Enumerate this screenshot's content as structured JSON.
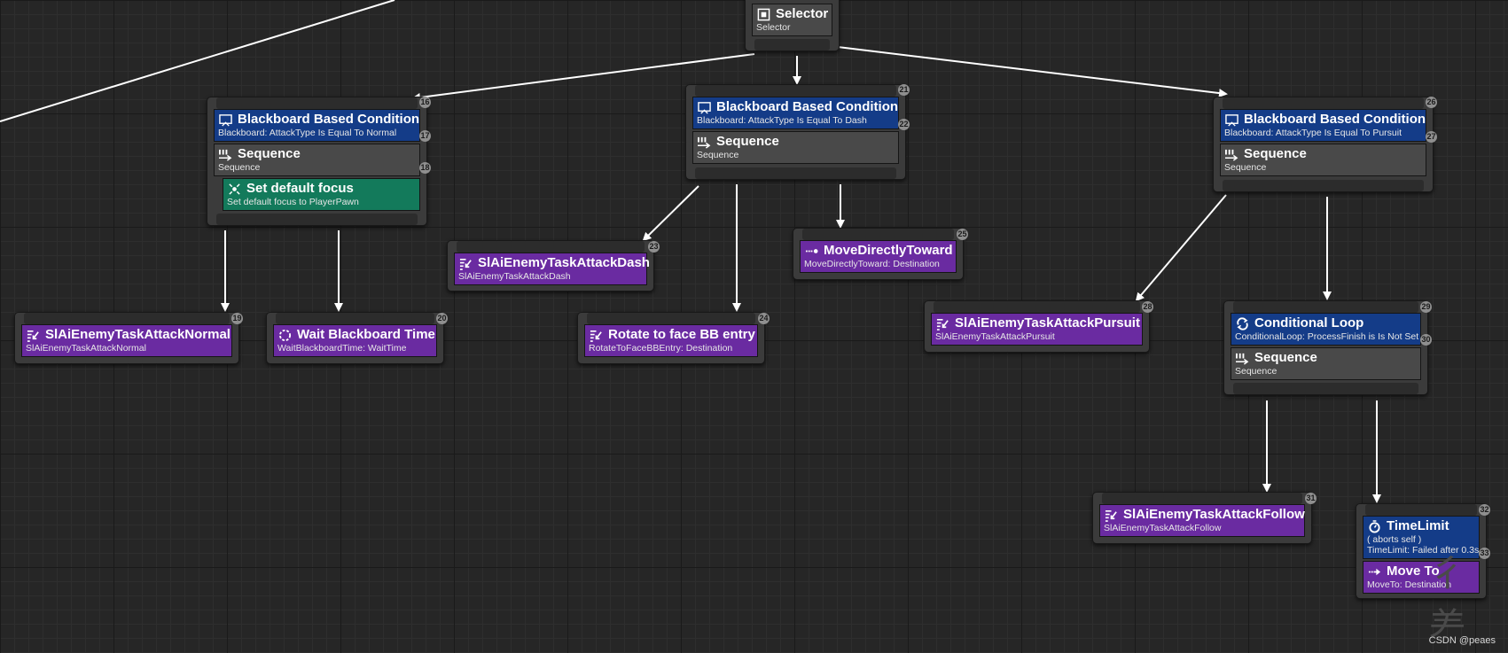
{
  "nodes": {
    "selector": {
      "title": "Selector",
      "sub": "Selector"
    },
    "n16": {
      "badges": [
        "16",
        "17",
        "18"
      ],
      "decorator": {
        "title": "Blackboard Based Condition",
        "sub": "Blackboard: AttackType Is Equal To Normal"
      },
      "composite": {
        "title": "Sequence",
        "sub": "Sequence"
      },
      "service": {
        "title": "Set default focus",
        "sub": "Set default focus to PlayerPawn"
      }
    },
    "n21": {
      "badges": [
        "21",
        "22"
      ],
      "decorator": {
        "title": "Blackboard Based Condition",
        "sub": "Blackboard: AttackType Is Equal To Dash"
      },
      "composite": {
        "title": "Sequence",
        "sub": "Sequence"
      }
    },
    "n26": {
      "badges": [
        "26",
        "27"
      ],
      "decorator": {
        "title": "Blackboard Based Condition",
        "sub": "Blackboard: AttackType Is Equal To Pursuit"
      },
      "composite": {
        "title": "Sequence",
        "sub": "Sequence"
      }
    },
    "n19": {
      "badge": "19",
      "title": "SlAiEnemyTaskAttackNormal",
      "sub": "SlAiEnemyTaskAttackNormal"
    },
    "n20": {
      "badge": "20",
      "title": "Wait Blackboard Time",
      "sub": "WaitBlackboardTime: WaitTime"
    },
    "n23": {
      "badge": "23",
      "title": "SlAiEnemyTaskAttackDash",
      "sub": "SlAiEnemyTaskAttackDash"
    },
    "n24": {
      "badge": "24",
      "title": "Rotate to face BB entry",
      "sub": "RotateToFaceBBEntry: Destination"
    },
    "n25": {
      "badge": "25",
      "title": "MoveDirectlyToward",
      "sub": "MoveDirectlyToward: Destination"
    },
    "n28": {
      "badge": "28",
      "title": "SlAiEnemyTaskAttackPursuit",
      "sub": "SlAiEnemyTaskAttackPursuit"
    },
    "n29": {
      "badges": [
        "29",
        "30"
      ],
      "decorator": {
        "title": "Conditional Loop",
        "sub": "ConditionalLoop: ProcessFinish is Is Not Set"
      },
      "composite": {
        "title": "Sequence",
        "sub": "Sequence"
      }
    },
    "n31": {
      "badge": "31",
      "title": "SlAiEnemyTaskAttackFollow",
      "sub": "SlAiEnemyTaskAttackFollow"
    },
    "n32": {
      "badges": [
        "32",
        "33"
      ],
      "decorator": {
        "title": "TimeLimit",
        "sub1": "( aborts self )",
        "sub2": "TimeLimit: Failed after 0.3s"
      },
      "task": {
        "title": "Move To",
        "sub": "MoveTo: Destination"
      }
    }
  },
  "watermark": "CSDN @peaes",
  "colors": {
    "decorator": "#143c88",
    "composite": "#494949",
    "service": "#137a5b",
    "task": "#6a2ba1",
    "wire": "#ffffff"
  },
  "icons": [
    "selector-icon",
    "decorator-icon",
    "sequence-icon",
    "focus-icon",
    "task-icon",
    "wait-icon",
    "move-icon",
    "loop-icon",
    "timer-icon"
  ]
}
